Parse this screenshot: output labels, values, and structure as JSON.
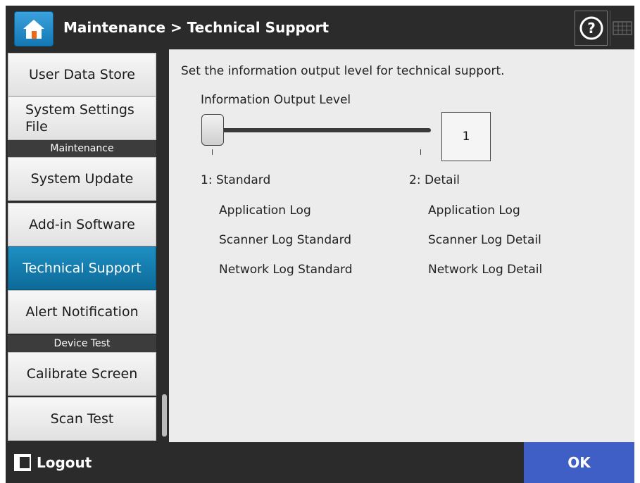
{
  "header": {
    "title": "Maintenance > Technical Support",
    "home_icon": "home-icon",
    "help_icon": "help-icon",
    "keyboard_icon": "keyboard-icon"
  },
  "sidebar": {
    "items": [
      {
        "label": "User Data Store"
      },
      {
        "label": "System Settings File"
      },
      {
        "label": "System Update"
      },
      {
        "label": "Add-in Software"
      },
      {
        "label": "Technical Support",
        "active": true
      },
      {
        "label": "Alert Notification"
      },
      {
        "label": "Calibrate Screen"
      },
      {
        "label": "Scan Test"
      }
    ],
    "sections": {
      "maintenance": "Maintenance",
      "device_test": "Device Test"
    }
  },
  "main": {
    "description": "Set the information output level for technical support.",
    "slider_label": "Information Output Level",
    "slider_value": "1",
    "slider_min": 1,
    "slider_max": 2,
    "level1": {
      "title": "1: Standard",
      "items": [
        "Application Log",
        "Scanner Log Standard",
        "Network Log Standard"
      ]
    },
    "level2": {
      "title": "2: Detail",
      "items": [
        "Application Log",
        "Scanner Log Detail",
        "Network Log Detail"
      ]
    }
  },
  "footer": {
    "logout_label": "Logout",
    "ok_label": "OK"
  },
  "colors": {
    "active": "#0c6a98",
    "ok_button": "#3f5fc6",
    "chrome": "#2b2b2b"
  }
}
